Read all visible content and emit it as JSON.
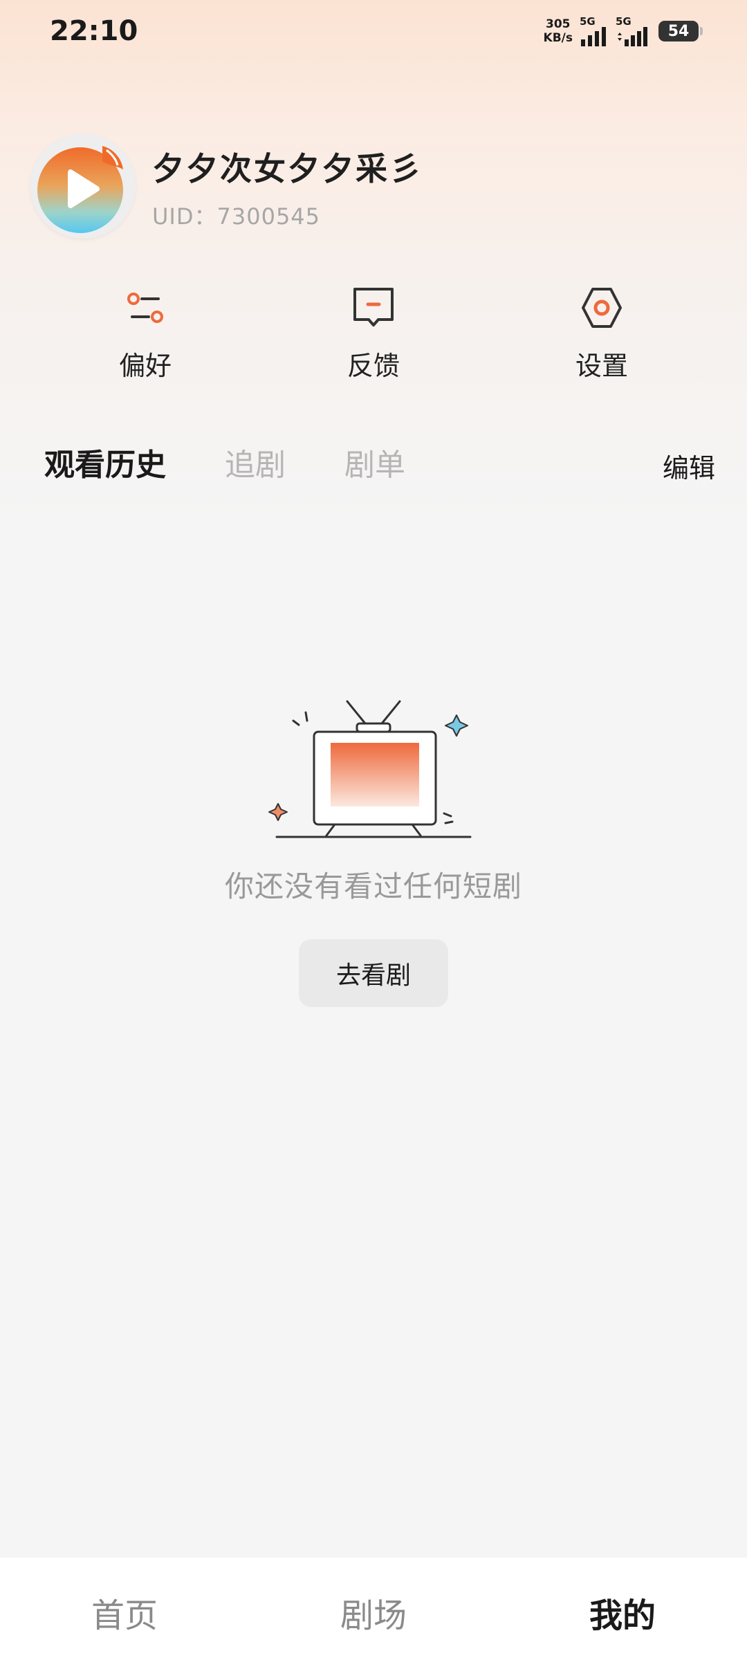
{
  "status_bar": {
    "time": "22:10",
    "net_speed_value": "305",
    "net_speed_unit": "KB/s",
    "signal1_label": "5G",
    "signal2_label": "5G",
    "battery": "54"
  },
  "profile": {
    "username": "夕夕次女夕夕采彡",
    "uid": "UID：7300545"
  },
  "quick_actions": [
    {
      "label": "偏好",
      "icon": "preferences-icon"
    },
    {
      "label": "反馈",
      "icon": "feedback-icon"
    },
    {
      "label": "设置",
      "icon": "settings-icon"
    }
  ],
  "tabs": [
    {
      "label": "观看历史",
      "active": true
    },
    {
      "label": "追剧",
      "active": false
    },
    {
      "label": "剧单",
      "active": false
    }
  ],
  "edit_label": "编辑",
  "empty_state": {
    "message": "你还没有看过任何短剧",
    "button_label": "去看剧",
    "illustration": "tv-illustration"
  },
  "bottom_nav": [
    {
      "label": "首页",
      "active": false
    },
    {
      "label": "剧场",
      "active": false
    },
    {
      "label": "我的",
      "active": true
    }
  ],
  "colors": {
    "accent": "#ee6a3c",
    "header_gradient_top": "#fbe3d3",
    "background": "#f5f5f5",
    "muted_text": "#999999"
  }
}
